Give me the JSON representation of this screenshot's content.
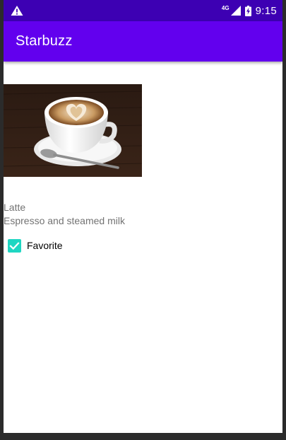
{
  "status_bar": {
    "warning_icon": "warning-icon",
    "network_label": "4G",
    "time": "9:15",
    "color": "#3d00b3"
  },
  "app_bar": {
    "title": "Starbuzz",
    "color": "#6200ee"
  },
  "drink": {
    "image_icon": "latte-photo",
    "name": "Latte",
    "description": "Espresso and steamed milk",
    "favorite_label": "Favorite",
    "favorite_checked": true,
    "checkbox_color": "#1fd6c2"
  }
}
